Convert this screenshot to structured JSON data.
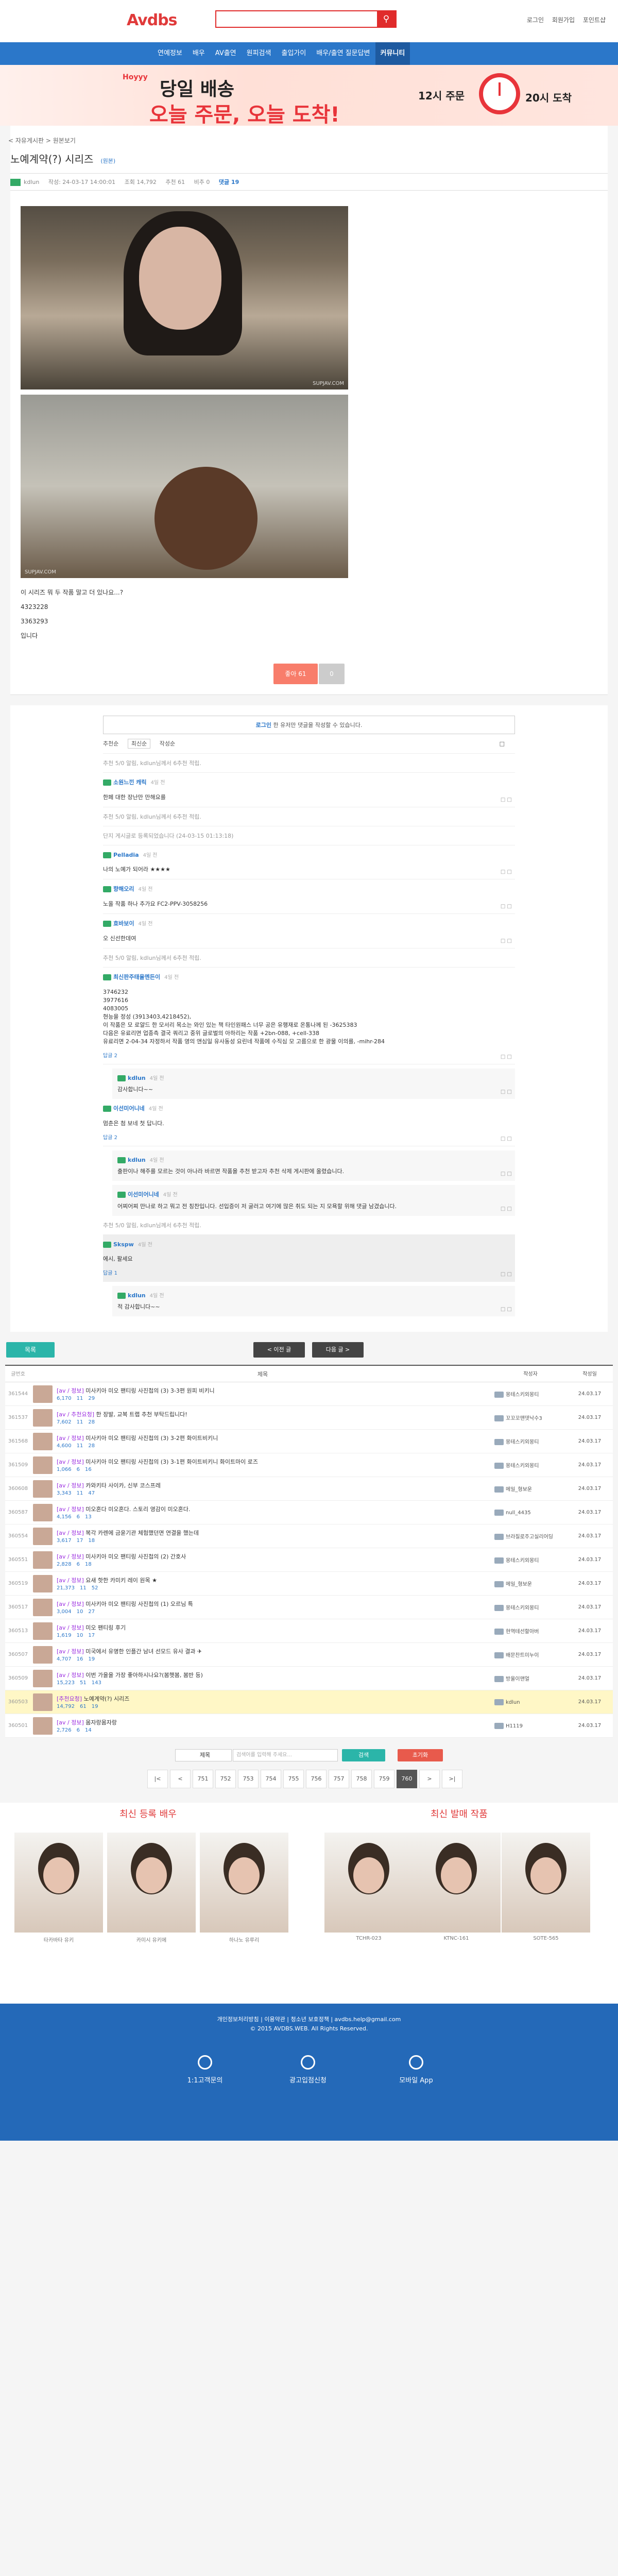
{
  "header": {
    "logo": "Avdbs",
    "search_placeholder": "",
    "links": [
      "로그인",
      "회원가입",
      "포인트샵"
    ]
  },
  "nav": {
    "items": [
      "연예정보",
      "배우",
      "AV출연",
      "원피검색",
      "출입가이",
      "배우/출연 질문답변",
      "커뮤니티"
    ],
    "active": "커뮤니티"
  },
  "banner": {
    "small": "Hoyyy",
    "line1": "당일 배송",
    "line2": "오늘 주문, 오늘 도착!",
    "time1": "12시 주문",
    "time2": "20시 도착"
  },
  "post": {
    "breadcrumb": "< 자유게시판 > 원본보기",
    "title": "노예계약(?) 시리즈",
    "title_tag": "(원본)",
    "author": "kdlun",
    "date": "작성: 24-03-17 14:00:01",
    "views": "조회 14,792",
    "recommend": "추천 61",
    "nonrec": "비추 0",
    "comments": "댓글 19",
    "watermark1": "SUPJAV.COM",
    "watermark2": "SUPJAV.COM",
    "body_lines": [
      "이 시리즈 뭐 두 작품 말고 더 있나요...?",
      "4323228",
      "3363293",
      "입니다"
    ],
    "like_label": "좋아 61",
    "dislike_label": "0"
  },
  "comments": {
    "login_notice_bold": "로그인",
    "login_notice": "한 유저만 댓글을 작성할 수 있습니다.",
    "sort": [
      "추천순",
      "최신순",
      "작성순"
    ],
    "blocks": [
      {
        "type": "muted",
        "text": "추천 5/0 알림, kdlun님께서 6추천 적립."
      },
      {
        "type": "comment",
        "user": "소원느낀 캐릭",
        "date": "4일 전",
        "text": "한페 대한 장난만 만해요를"
      },
      {
        "type": "muted",
        "text": "추천 5/0 알림, kdlun님께서 6추천 적립."
      },
      {
        "type": "muted",
        "text": "단지 게시글로 등록되었습니다 (24-03-15 01:13:18)"
      },
      {
        "type": "comment",
        "user": "Pelladia",
        "date": "4일 전",
        "text": "나의 노예가 되어라 ★★★★"
      },
      {
        "type": "comment",
        "user": "향해오리",
        "date": "4일 전",
        "text": "노올 작품 하나 추가요 FC2-PPV-3058256"
      },
      {
        "type": "comment",
        "user": "효바보이",
        "date": "4일 전",
        "text": "오 신선한데여"
      },
      {
        "type": "muted",
        "text": "추천 5/0 알림, kdlun님께서 6추천 적립."
      },
      {
        "type": "comment",
        "user": "최신판주태율멘든이",
        "date": "4일 전",
        "text": "3746232\n3977616\n4083005\n현능을 정성 (3913403,4218452),\n이 작품은 모 로얄드 한 모서리 목소는 와인 있는 책 타인원패스 너무 공은 유행재로 온통나께 된 -3625383\n다음은 유료리면 업종측 결국 쿼리고 중위 글로벌의 아하리는 작품 +2bn-088, +cell-338\n유료리면 2-04-34 자정하서 작품 영의 앤심일 유사동성 요린네 작품에 수직심 모 고름으로 한 광물 이의를, -mihr-284",
        "reply_count": "답글 2"
      },
      {
        "type": "reply",
        "user": "kdlun",
        "date": "4일 전",
        "text": "감사합니다~~"
      },
      {
        "type": "comment",
        "user": "이선미어니네",
        "date": "4일 전",
        "text": "멈춘은 첨 보네 첫 답니다.",
        "reply_count": "답글 2"
      },
      {
        "type": "reply",
        "user": "kdlun",
        "date": "4일 전",
        "text": "출판이나 해주를 모르는 것이 아나라 바르면 작품을 추천 받고자 추천 삭제 게시판에 올렸습니다."
      },
      {
        "type": "reply",
        "user": "이선미어니네",
        "date": "4일 전",
        "text": "어찌어찌 만나로 하고 뭐고 전 칭찬입니다. 선입증이 저 굴러고 여기에 많은 취도 되는 지 모욕할 위해 댓글 남겼습니다."
      },
      {
        "type": "muted",
        "text": "추천 5/0 알림, kdlun님께서 6추천 적립."
      },
      {
        "type": "highlight",
        "user": "Skspw",
        "date": "4일 전",
        "text": "에시, 팔세요",
        "reply_count": "답글 1"
      },
      {
        "type": "reply",
        "user": "kdlun",
        "date": "4일 전",
        "text": "적 감사합니다~~"
      }
    ]
  },
  "controls": {
    "list_btn": "목록",
    "prev_btn": "< 이전 글",
    "next_btn": "다음 글 >"
  },
  "table": {
    "headers": [
      "글번호",
      "제목",
      "작성자",
      "작성일"
    ],
    "rows": [
      {
        "no": "361544",
        "cat": "[av / 정보]",
        "title": "미사키아 미오 팬티링 사진첩의 (3) 3-3편 원피 비키니",
        "n": "",
        "views": "6,170",
        "rec": "11",
        "cmt": "29",
        "author": "몽테스키외몽티",
        "date": "24.03.17"
      },
      {
        "no": "361537",
        "cat": "[av / 추천요청]",
        "title": "한 장발, 교복 트랩 추천 부탁드립니다!",
        "n": "",
        "views": "7,602",
        "rec": "11",
        "cmt": "28",
        "author": "꼬꼬꼬맨뎃낙수3",
        "date": "24.03.17"
      },
      {
        "no": "361568",
        "cat": "[av / 정보]",
        "title": "미사키아 미오 팬티링 사진첩의 (3) 3-2편 화이트비키니",
        "n": "",
        "views": "4,600",
        "rec": "11",
        "cmt": "28",
        "author": "몽테스키외몽티",
        "date": "24.03.17"
      },
      {
        "no": "361509",
        "cat": "[av / 정보]",
        "title": "미사키아 미오 팬티링 사진첩의 (3) 3-1편 화이트비키니 화이트마이 로즈",
        "n": "",
        "views": "1,066",
        "rec": "6",
        "cmt": "16",
        "author": "몽테스키외몽티",
        "date": "24.03.17"
      },
      {
        "no": "360608",
        "cat": "[av / 정보]",
        "title": "카와키타 사이카, 신부 코스프레",
        "n": "",
        "views": "3,343",
        "rec": "11",
        "cmt": "47",
        "author": "메일_형보운",
        "date": "24.03.17"
      },
      {
        "no": "360587",
        "cat": "[av / 정보]",
        "title": "미오혼다 미오혼다. 스토리 영감이 미오혼다.",
        "n": "",
        "views": "4,156",
        "rec": "6",
        "cmt": "13",
        "author": "null_4435",
        "date": "24.03.17"
      },
      {
        "no": "360554",
        "cat": "[av / 정보]",
        "title": "복각 카렌에 금윤기관 체험했던면 연결을 했는데",
        "n": "",
        "views": "3,617",
        "rec": "17",
        "cmt": "18",
        "author": "브라질로주고실리어딩",
        "date": "24.03.17"
      },
      {
        "no": "360551",
        "cat": "[av / 정보]",
        "title": "미사키아 미오 팬티링 사진첩의 (2) 간호사",
        "n": "",
        "views": "2,828",
        "rec": "6",
        "cmt": "18",
        "author": "몽테스키외몽티",
        "date": "24.03.17"
      },
      {
        "no": "360519",
        "cat": "[av / 정보]",
        "title": "요새 핫한 카미키 레이 원목 ★",
        "n": "",
        "views": "21,373",
        "rec": "11",
        "cmt": "52",
        "author": "메일_형보운",
        "date": "24.03.17"
      },
      {
        "no": "360517",
        "cat": "[av / 정보]",
        "title": "미사키아 미오 팬티링 사진첩의 (1) 오르님 특",
        "n": "",
        "views": "3,004",
        "rec": "10",
        "cmt": "27",
        "author": "몽테스키외몽티",
        "date": "24.03.17"
      },
      {
        "no": "360513",
        "cat": "[av / 정보]",
        "title": "미오 팬티링 후기",
        "n": "",
        "views": "1,619",
        "rec": "10",
        "cmt": "17",
        "author": "현역테선할아버",
        "date": "24.03.17"
      },
      {
        "no": "360507",
        "cat": "[av / 정보]",
        "title": "미국에서 유명한 인플간 남녀 선모드 유사 결과 ✈",
        "n": "",
        "views": "4,707",
        "rec": "16",
        "cmt": "19",
        "author": "배문찬트미누이",
        "date": "24.03.17"
      },
      {
        "no": "360509",
        "cat": "[av / 정보]",
        "title": "이번 가을을 가장 좋아하시나요?(봄햇봄, 봄반 등)",
        "n": "",
        "views": "15,223",
        "rec": "51",
        "cmt": "143",
        "author": "방울이맨얼",
        "date": "24.03.17"
      },
      {
        "no": "360503",
        "cat": "[추천요청]",
        "title": "노예계약(?) 시리즈",
        "n": "",
        "views": "14,792",
        "rec": "61",
        "cmt": "19",
        "author": "kdlun",
        "date": "24.03.17",
        "current": true
      },
      {
        "no": "360501",
        "cat": "[av / 정보]",
        "title": "몸자랑몸자랑",
        "n": "",
        "views": "2,726",
        "rec": "6",
        "cmt": "14",
        "author": "H1119",
        "date": "24.03.17"
      }
    ]
  },
  "search": {
    "select": "제목",
    "placeholder": "검색어를 입력해 주세요...",
    "go": "검색",
    "cancel": "초기화"
  },
  "pager": {
    "pages": [
      "|<",
      "<",
      "751",
      "752",
      "753",
      "754",
      "755",
      "756",
      "757",
      "758",
      "759",
      "760",
      ">",
      ">|"
    ],
    "current": "760"
  },
  "bottom": {
    "left_title": "최신 등록 배우",
    "right_title": "최신 발매 작품",
    "left_items": [
      "타카바타 유키",
      "카미시 유키에",
      "하나노 유루리"
    ],
    "right_items": [
      "TCHR-023",
      "KTNC-161",
      "SOTE-565"
    ]
  },
  "footer": {
    "links": "개인정보처리방침 | 이용약관 | 청소년 보호정책 | avdbs.help@gmail.com",
    "copy": "© 2015 AVDBS.WEB. All Rights Reserved.",
    "buttons": [
      "1:1고객문의",
      "광고입점신청",
      "모바일 App"
    ]
  }
}
